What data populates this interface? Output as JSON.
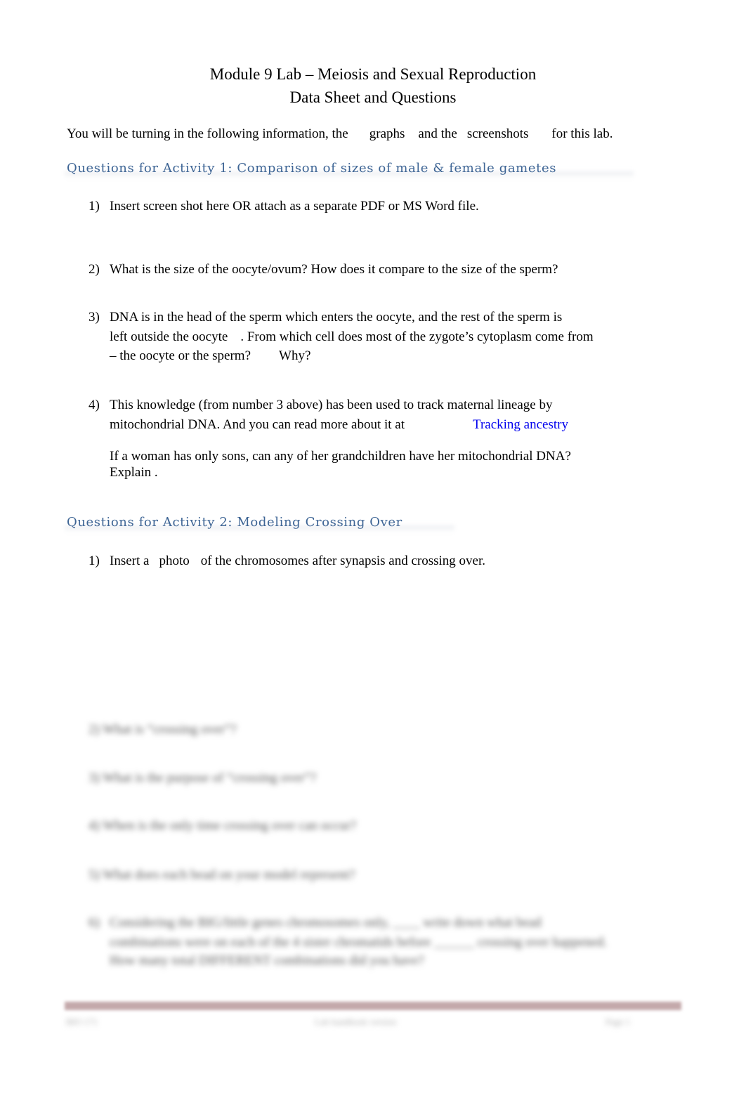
{
  "doc": {
    "title_line1": "Module 9 Lab – Meiosis and Sexual Reproduction",
    "title_line2": "Data Sheet and Questions",
    "intro": {
      "part1": "You will be turning in the following information, the",
      "graphs": "graphs",
      "and_the": "and the",
      "screenshots": "screenshots",
      "end": "for this lab."
    },
    "activity1": {
      "heading": "Questions for Activity 1: Comparison of sizes of male & female gametes",
      "q1": {
        "num": "1)",
        "text": "Insert screen shot here OR attach as a separate PDF or MS Word file."
      },
      "q2": {
        "num": "2)",
        "text": "What is the size of the oocyte/ovum? How does it compare to the size of the sperm?"
      },
      "q3": {
        "num": "3)",
        "line1": "DNA is in the head of the sperm which enters the oocyte, and the rest of the sperm is",
        "line2a": "left outside the oocyte",
        "line2b": ".  From which cell does most of the zygote’s cytoplasm come from",
        "line3a": "– the oocyte or the sperm?",
        "line3b": "Why?"
      },
      "q4": {
        "num": "4)",
        "line1": "This knowledge (from number 3 above) has been used to track maternal lineage by",
        "line2a": "mitochondrial DNA.   And you can read more about it at",
        "link": "Tracking ancestry",
        "line3": "If a woman has only sons, can any of her grandchildren have her mitochondrial DNA?",
        "line4": "Explain  ."
      }
    },
    "activity2": {
      "heading": "Questions for Activity 2: Modeling Crossing Over",
      "q1": {
        "num": "1)",
        "a": "Insert a",
        "photo": "photo",
        "b": "of the chromosomes after synapsis and crossing over."
      },
      "blurred": [
        {
          "num": "2)",
          "text": "What is “crossing over”?"
        },
        {
          "num": "3)",
          "text": "What is the purpose of “crossing over”?"
        },
        {
          "num": "4)",
          "text": "When is the only time crossing over can occur?"
        },
        {
          "num": "5)",
          "text": "What does each bead on your model represent?"
        }
      ],
      "q6": {
        "num": "6)",
        "line1": "Considering the BIG/little genes chromosomes only,  ____ write down what bead",
        "line2": "combinations were on each of the 4 sister chromatids before ______ crossing over happened.",
        "line3": "How many total DIFFERENT combinations did you have?"
      }
    },
    "footer": {
      "left": "BIO 171",
      "center": "Lab handbook version",
      "right": "Page 1"
    }
  }
}
